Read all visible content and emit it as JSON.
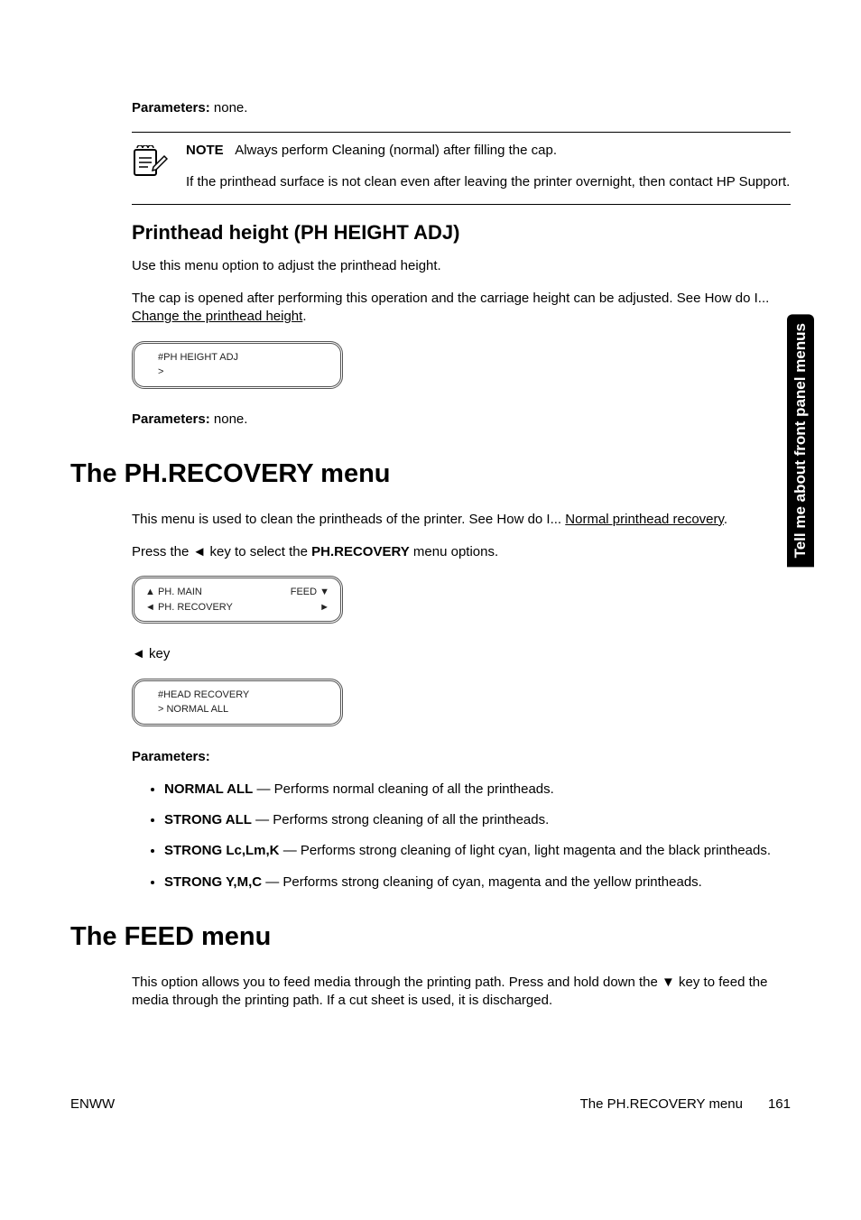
{
  "p_params_none_1": "Parameters:",
  "p_params_none_1b": " none.",
  "note_label": "NOTE",
  "note_line1": "Always perform Cleaning (normal) after filling the cap.",
  "note_line2": "If the printhead surface is not clean even after leaving the printer overnight, then contact HP Support.",
  "h_printhead": "Printhead height (PH HEIGHT ADJ)",
  "p_use_menu": "Use this menu option to adjust the printhead height.",
  "p_cap_opened_a": "The cap is opened after performing this operation and the carriage height can be adjusted. See How do I... ",
  "p_cap_opened_link": "Change the printhead height",
  "p_cap_opened_b": ".",
  "lcd1_l1": "#PH HEIGHT ADJ",
  "lcd1_l2": ">",
  "p_params_none_2": "Parameters:",
  "p_params_none_2b": " none.",
  "h_phrecovery": "The PH.RECOVERY menu",
  "p_rec_intro_a": "This menu is used to clean the printheads of the printer. See How do I... ",
  "p_rec_intro_link": "Normal printhead recovery",
  "p_rec_intro_b": ".",
  "p_press_a": "Press the ◄ key to select the ",
  "p_press_b": "PH.RECOVERY",
  "p_press_c": " menu options.",
  "lcd2_l1": "▲ PH. MAIN",
  "lcd2_l2": "◄ PH. RECOVERY",
  "lcd2_r1": "FEED  ▼",
  "lcd2_r2": "►",
  "p_key": "◄ key",
  "lcd3_l1": "#HEAD RECOVERY",
  "lcd3_l2": "> NORMAL ALL",
  "p_params_label": "Parameters:",
  "param1_name": "NORMAL ALL",
  "param1_desc": " — Performs normal cleaning of all the printheads.",
  "param2_name": "STRONG ALL",
  "param2_desc": " — Performs strong cleaning of all the printheads.",
  "param3_name": "STRONG Lc,Lm,K ",
  "param3_desc": " — Performs strong cleaning of light cyan, light magenta and the black printheads.",
  "param4_name": "STRONG Y,M,C ",
  "param4_desc": " — Performs strong cleaning of cyan, magenta and the yellow printheads.",
  "h_feed": "The FEED menu",
  "p_feed": "This option allows you to feed media through the printing path. Press and hold down the ▼ key to feed the media through the printing path. If a cut sheet is used, it is discharged.",
  "side_tab": "Tell me about front panel menus",
  "footer_left": "ENWW",
  "footer_right_title": "The PH.RECOVERY menu",
  "footer_page": "161"
}
